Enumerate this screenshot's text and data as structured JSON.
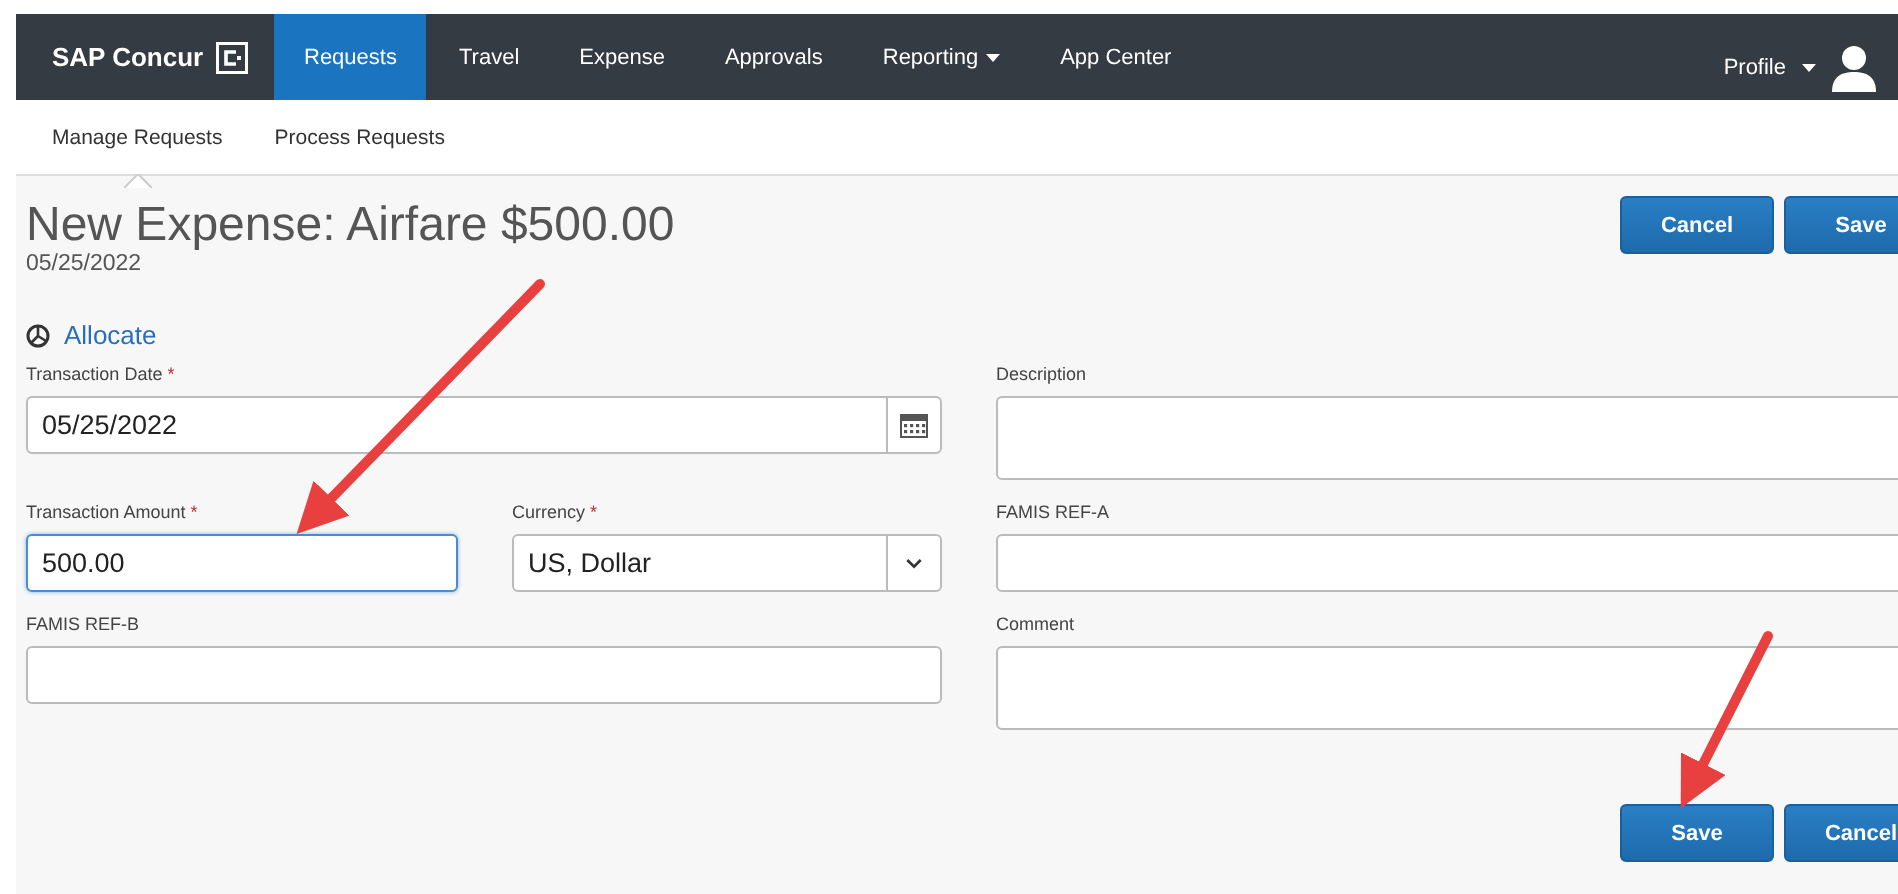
{
  "nav": {
    "logo": "SAP Concur",
    "tabs": [
      {
        "label": "Requests",
        "selected": true,
        "dropdown": false
      },
      {
        "label": "Travel",
        "selected": false,
        "dropdown": false
      },
      {
        "label": "Expense",
        "selected": false,
        "dropdown": false
      },
      {
        "label": "Approvals",
        "selected": false,
        "dropdown": false
      },
      {
        "label": "Reporting",
        "selected": false,
        "dropdown": true
      },
      {
        "label": "App Center",
        "selected": false,
        "dropdown": false
      }
    ],
    "profile": "Profile"
  },
  "subnav": [
    {
      "label": "Manage Requests",
      "selected": true
    },
    {
      "label": "Process Requests",
      "selected": false
    }
  ],
  "header": {
    "title": "New Expense: Airfare $500.00",
    "date": "05/25/2022",
    "buttons": [
      "Cancel",
      "Save"
    ]
  },
  "allocate": "Allocate",
  "rows": [
    [
      {
        "label": "Transaction Date",
        "required_mark": "*",
        "kind": "date",
        "value": "05/25/2022",
        "focused": false
      },
      {
        "label": "Description",
        "kind": "textarea",
        "focused": false
      }
    ],
    [
      {
        "label": "Transaction Amount",
        "required_mark": "*",
        "kind": "text",
        "value": "500.00",
        "focused": true
      },
      {
        "label": "Currency",
        "required_mark": "*",
        "kind": "select",
        "value": "US, Dollar",
        "focused": false
      },
      {
        "label": "FAMIS REF-A",
        "kind": "text",
        "focused": false
      }
    ],
    [
      {
        "label": "FAMIS REF-B",
        "kind": "text",
        "focused": false
      },
      {
        "label": "Comment",
        "kind": "textarea",
        "focused": false
      }
    ]
  ],
  "footer_buttons": [
    "Save",
    "Cancel"
  ]
}
